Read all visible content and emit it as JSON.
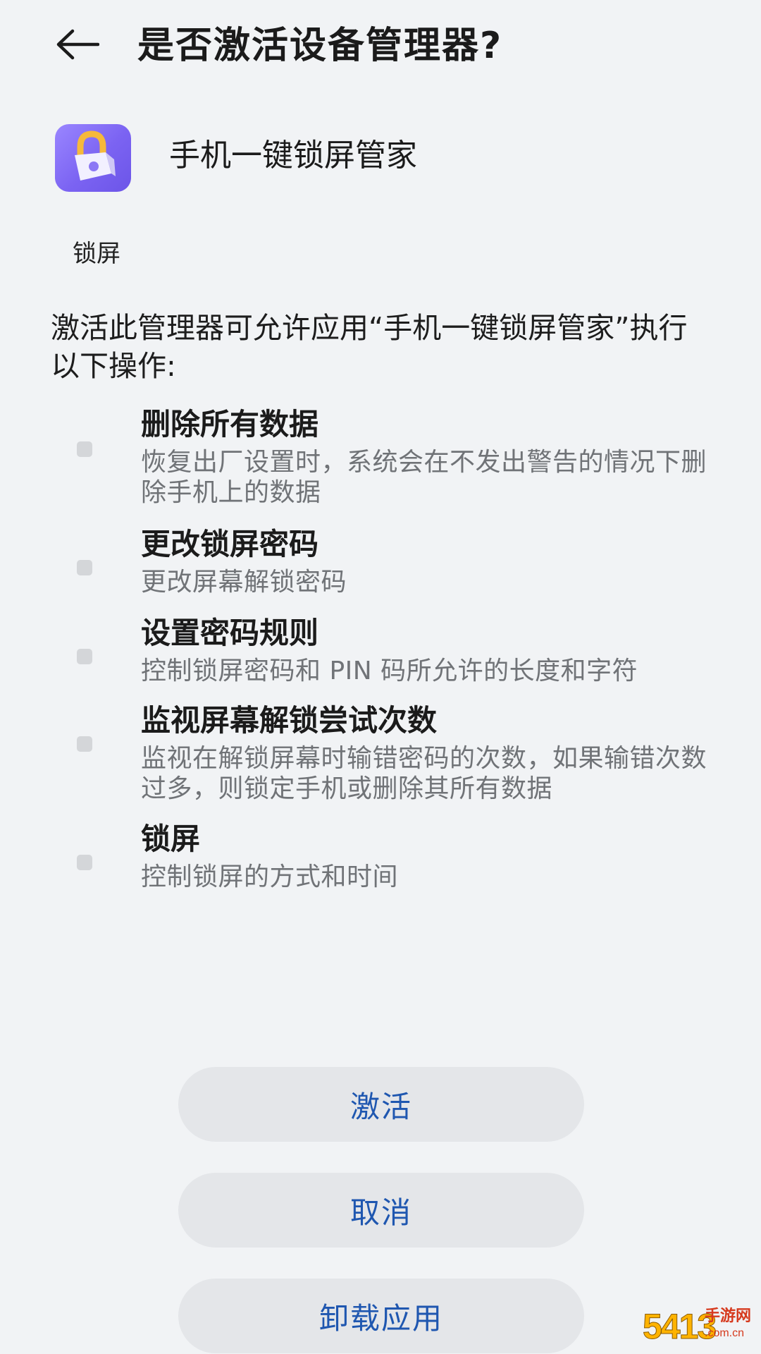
{
  "header": {
    "back_icon": "back-arrow-icon",
    "title": "是否激活设备管理器?"
  },
  "app": {
    "icon": "lock-icon",
    "name": "手机一键锁屏管家",
    "label": "锁屏"
  },
  "intro": "激活此管理器可允许应用“手机一键锁屏管家”执行以下操作:",
  "permissions": [
    {
      "title": "删除所有数据",
      "description": "恢复出厂设置时，系统会在不发出警告的情况下删除手机上的数据"
    },
    {
      "title": "更改锁屏密码",
      "description": "更改屏幕解锁密码"
    },
    {
      "title": "设置密码规则",
      "description": "控制锁屏密码和 PIN 码所允许的长度和字符"
    },
    {
      "title": "监视屏幕解锁尝试次数",
      "description": "监视在解锁屏幕时输错密码的次数，如果输错次数过多，则锁定手机或删除其所有数据"
    },
    {
      "title": "锁屏",
      "description": "控制锁屏的方式和时间"
    }
  ],
  "buttons": {
    "activate": "激活",
    "cancel": "取消",
    "uninstall": "卸载应用"
  },
  "watermark": {
    "number": "5413",
    "site": "手游网",
    "domain": ".com.cn"
  },
  "colors": {
    "background": "#f1f3f5",
    "button_text": "#1f57b0",
    "button_bg": "#e4e6e9",
    "icon_gradient_start": "#9a86ff",
    "icon_gradient_end": "#6c55e8"
  }
}
